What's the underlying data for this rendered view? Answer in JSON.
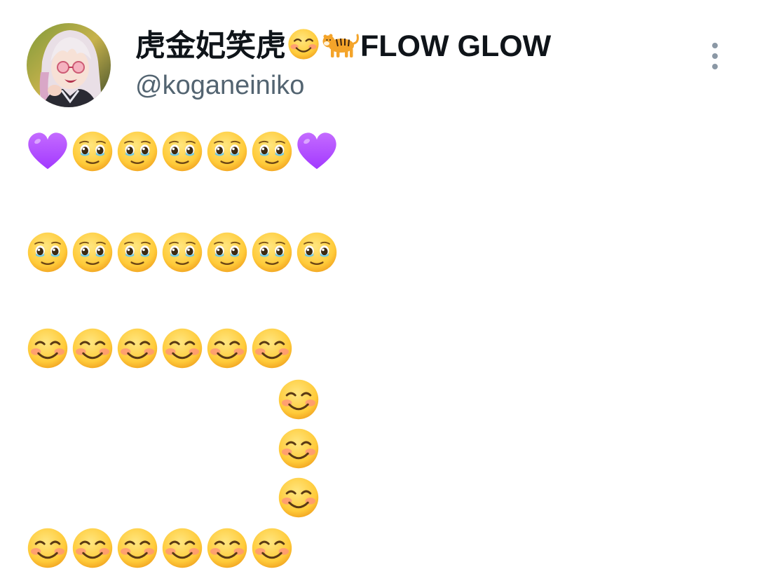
{
  "tweet": {
    "author": {
      "display_name": "虎金妃笑虎☺️🐅FLOW GLOW",
      "display_name_text": "虎金妃笑虎",
      "display_name_emojis": [
        "smiling-face-emoji",
        "tiger-emoji"
      ],
      "display_name_suffix": "FLOW GLOW",
      "handle": "@koganeiniko"
    },
    "more_icon": "vertical-ellipsis-icon",
    "body_text": "💜🥹🥹🥹🥹🥹💜\n\n🥹🥹🥹🥹🥹🥹🥹\n\n☺️☺️☺️☺️☺️☺️\n                        ☺️\n                        ☺️\n                        ☺️\n☺️☺️☺️☺️☺️☺️",
    "body_rows": [
      [
        "purple-heart",
        "holding-back-tears",
        "holding-back-tears",
        "holding-back-tears",
        "holding-back-tears",
        "holding-back-tears",
        "purple-heart"
      ],
      [
        "holding-back-tears",
        "holding-back-tears",
        "holding-back-tears",
        "holding-back-tears",
        "holding-back-tears",
        "holding-back-tears",
        "holding-back-tears"
      ],
      [
        "smiling-face",
        "smiling-face",
        "smiling-face",
        "smiling-face",
        "smiling-face",
        "smiling-face"
      ],
      [
        "smiling-face"
      ],
      [
        "smiling-face"
      ],
      [
        "smiling-face"
      ],
      [
        "smiling-face",
        "smiling-face",
        "smiling-face",
        "smiling-face",
        "smiling-face",
        "smiling-face"
      ]
    ]
  },
  "colors": {
    "name": "#0f1419",
    "handle": "#536471",
    "more_icon": "#8b98a5",
    "face_yellow": "#ffcb3a",
    "heart_purple": "#a239ff",
    "blush": "#ff8a80"
  }
}
